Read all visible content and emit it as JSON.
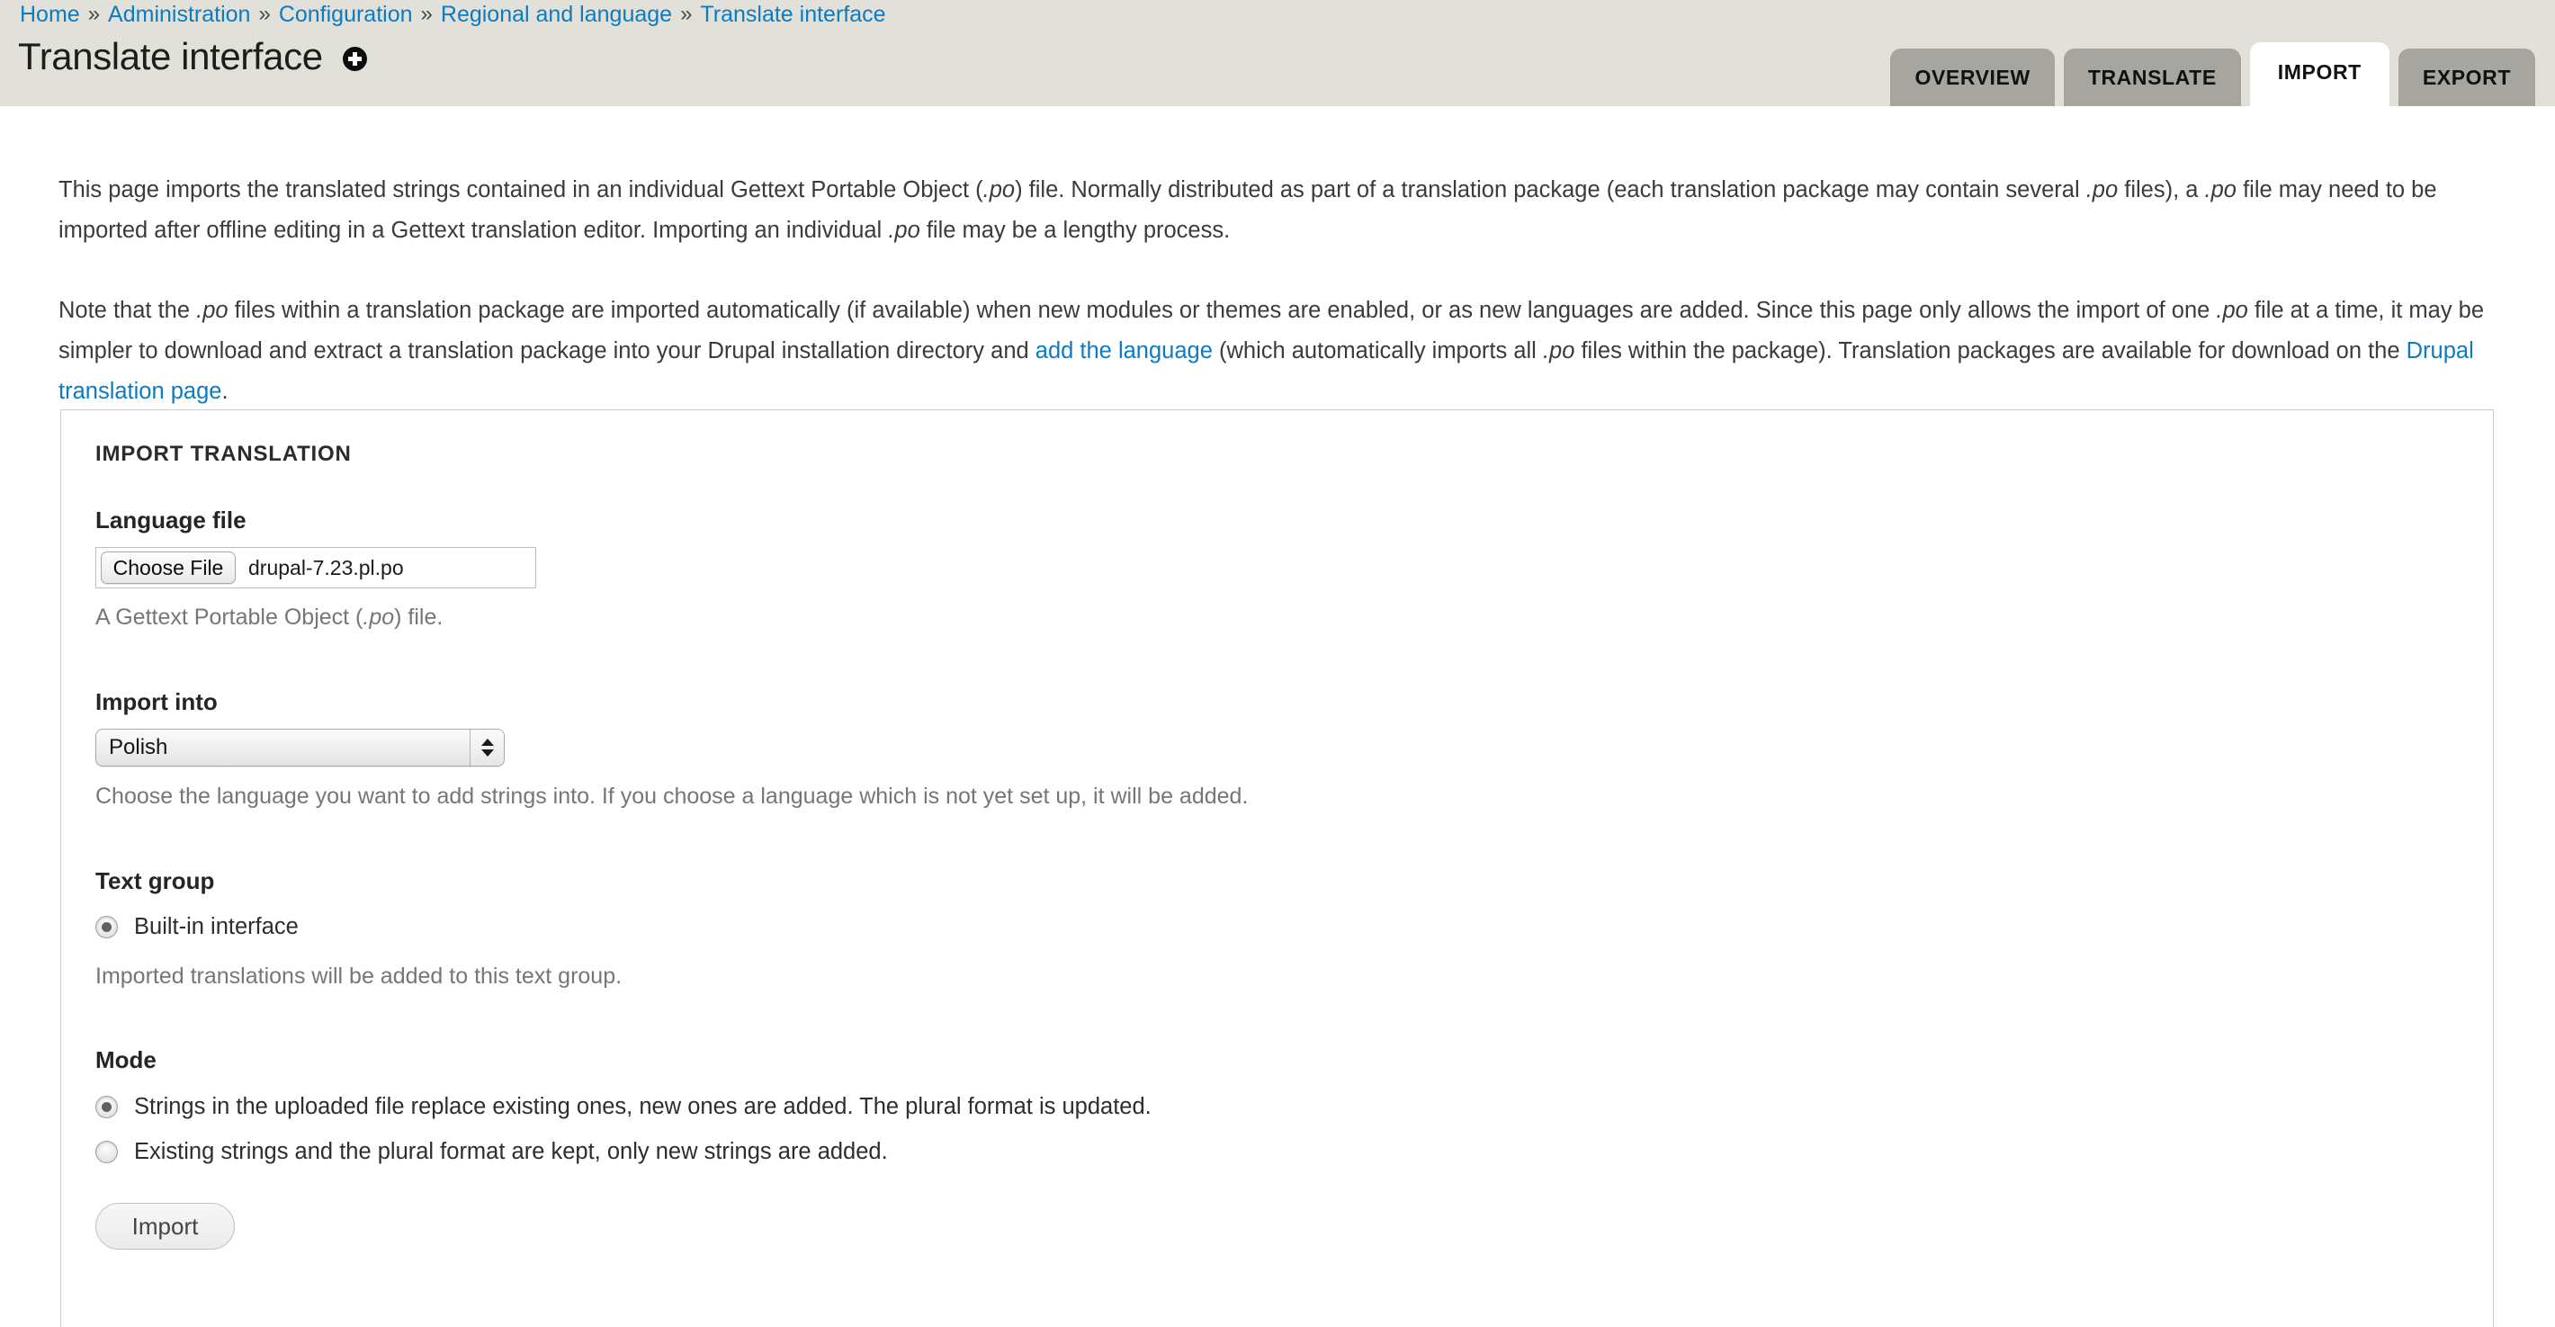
{
  "breadcrumb": {
    "separator": "»",
    "items": [
      {
        "label": "Home"
      },
      {
        "label": "Administration"
      },
      {
        "label": "Configuration"
      },
      {
        "label": "Regional and language"
      },
      {
        "label": "Translate interface"
      }
    ]
  },
  "header": {
    "title": "Translate interface",
    "help_icon": "plus-circle-icon"
  },
  "tabs": [
    {
      "label": "OVERVIEW",
      "active": false
    },
    {
      "label": "TRANSLATE",
      "active": false
    },
    {
      "label": "IMPORT",
      "active": true
    },
    {
      "label": "EXPORT",
      "active": false
    }
  ],
  "intro": {
    "p1_a": "This page imports the translated strings contained in an individual Gettext Portable Object (",
    "p1_i1": ".po",
    "p1_b": ") file. Normally distributed as part of a translation package (each translation package may contain several ",
    "p1_i2": ".po",
    "p1_c": " files), a ",
    "p1_i3": ".po",
    "p1_d": " file may need to be imported after offline editing in a Gettext translation editor. Importing an individual ",
    "p1_i4": ".po",
    "p1_e": " file may be a lengthy process.",
    "p2_a": "Note that the ",
    "p2_i1": ".po",
    "p2_b": " files within a translation package are imported automatically (if available) when new modules or themes are enabled, or as new languages are added. Since this page only allows the import of one ",
    "p2_i2": ".po",
    "p2_c": " file at a time, it may be simpler to download and extract a translation package into your Drupal installation directory and ",
    "p2_link1": "add the language",
    "p2_d": " (which automatically imports all ",
    "p2_i3": ".po",
    "p2_e": " files within the package). Translation packages are available for download on the ",
    "p2_link2": "Drupal translation page",
    "p2_f": "."
  },
  "form": {
    "legend": "IMPORT TRANSLATION",
    "language_file": {
      "label": "Language file",
      "choose_button": "Choose File",
      "file_name": "drupal-7.23.pl.po",
      "desc_a": "A Gettext Portable Object (",
      "desc_i": ".po",
      "desc_b": ") file."
    },
    "import_into": {
      "label": "Import into",
      "selected": "Polish",
      "description": "Choose the language you want to add strings into. If you choose a language which is not yet set up, it will be added."
    },
    "text_group": {
      "label": "Text group",
      "option_label": "Built-in interface",
      "option_checked": true,
      "description": "Imported translations will be added to this text group."
    },
    "mode": {
      "label": "Mode",
      "options": [
        {
          "label": "Strings in the uploaded file replace existing ones, new ones are added. The plural format is updated.",
          "checked": true
        },
        {
          "label": "Existing strings and the plural format are kept, only new strings are added.",
          "checked": false
        }
      ]
    },
    "submit_label": "Import"
  },
  "colors": {
    "header_bg": "#e2e1d9",
    "link": "#0c7bc1",
    "tab_inactive": "#a6a59f",
    "tab_active": "#ffffff",
    "body_text": "#3b3b3b",
    "description_text": "#767676",
    "fieldset_border": "#cccccc"
  }
}
